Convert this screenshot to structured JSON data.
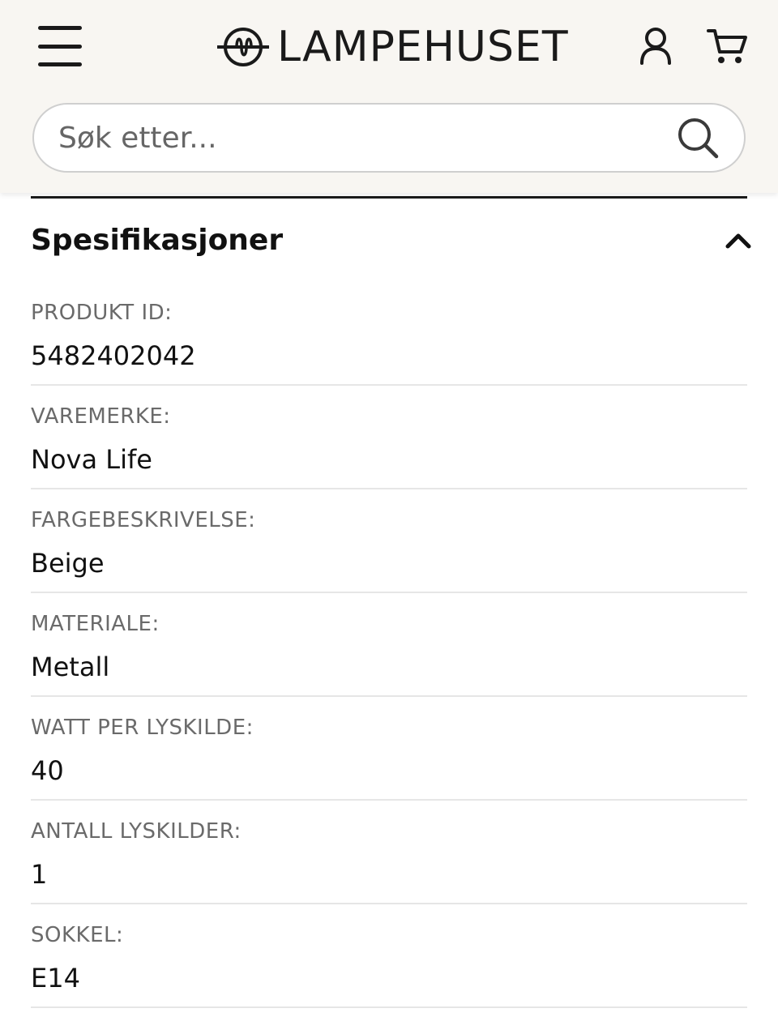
{
  "header": {
    "brand": "LAMPEHUSET",
    "icons": {
      "menu": "hamburger-menu-icon",
      "logo": "bulb-filament-logo",
      "account": "user-icon",
      "cart": "shopping-cart-icon"
    }
  },
  "search": {
    "placeholder": "Søk etter...",
    "value": "",
    "icon": "search-icon"
  },
  "specifications": {
    "title": "Spesifikasjoner",
    "expanded": true,
    "items": [
      {
        "label": "PRODUKT ID:",
        "value": "5482402042"
      },
      {
        "label": "VAREMERKE:",
        "value": "Nova Life"
      },
      {
        "label": "FARGEBESKRIVELSE:",
        "value": "Beige"
      },
      {
        "label": "MATERIALE:",
        "value": "Metall"
      },
      {
        "label": "WATT PER LYSKILDE:",
        "value": "40"
      },
      {
        "label": "ANTALL LYSKILDER:",
        "value": "1"
      },
      {
        "label": "SOKKEL:",
        "value": "E14"
      }
    ]
  },
  "colors": {
    "header_bg": "#f8f6f2",
    "text": "#111111",
    "label": "#6a6a6a",
    "divider": "#e6e6e6"
  }
}
